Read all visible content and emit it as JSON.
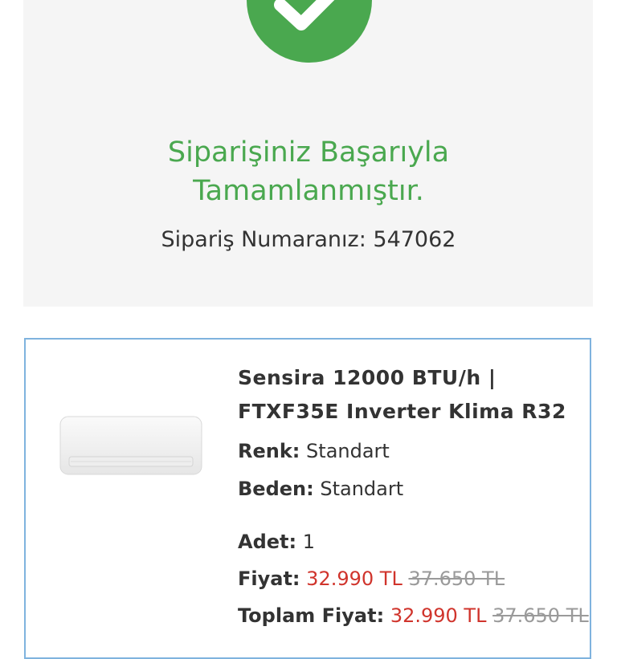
{
  "success": {
    "title_line1": "Siparişiniz Başarıyla",
    "title_line2": "Tamamlanmıştır.",
    "order_number_label": "Sipariş Numaranız:",
    "order_number": "547062",
    "accent_color": "#4aa84f"
  },
  "product": {
    "image_icon": "air-conditioner-unit-image",
    "name_line1": "Sensira 12000 BTU/h |",
    "name_line2": "FTXF35E Inverter Klima R32",
    "color_label": "Renk:",
    "color_value": "Standart",
    "size_label": "Beden:",
    "size_value": "Standart",
    "quantity_label": "Adet:",
    "quantity_value": "1",
    "price_label": "Fiyat:",
    "price_value": "32.990 TL",
    "price_old": "37.650 TL",
    "total_label": "Toplam Fiyat:",
    "total_value": "32.990 TL",
    "total_old": "37.650 TL",
    "price_color": "#d0342c"
  }
}
